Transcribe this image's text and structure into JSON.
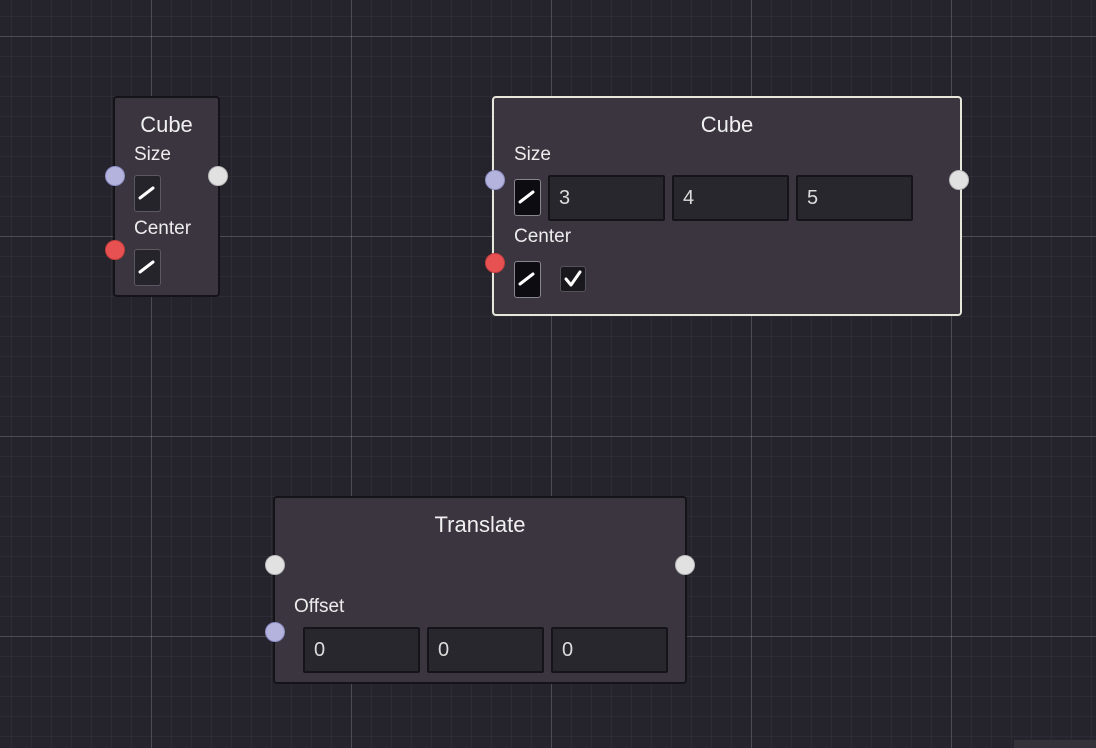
{
  "colors": {
    "canvas_bg": "#25242d",
    "node_bg": "#3b3540",
    "selected_border": "#e6e6da",
    "port_blue": "#b3b3dd",
    "port_red": "#e85151",
    "port_white": "#e1e1e1"
  },
  "nodes": {
    "cube_small": {
      "title": "Cube",
      "size_label": "Size",
      "center_label": "Center",
      "edit_icon": "pencil-icon"
    },
    "cube_selected": {
      "title": "Cube",
      "size_label": "Size",
      "size_values": [
        "3",
        "4",
        "5"
      ],
      "center_label": "Center",
      "center_checked": true,
      "edit_icon": "pencil-icon",
      "check_icon": "checkmark-icon"
    },
    "translate": {
      "title": "Translate",
      "offset_label": "Offset",
      "offset_values": [
        "0",
        "0",
        "0"
      ]
    }
  }
}
